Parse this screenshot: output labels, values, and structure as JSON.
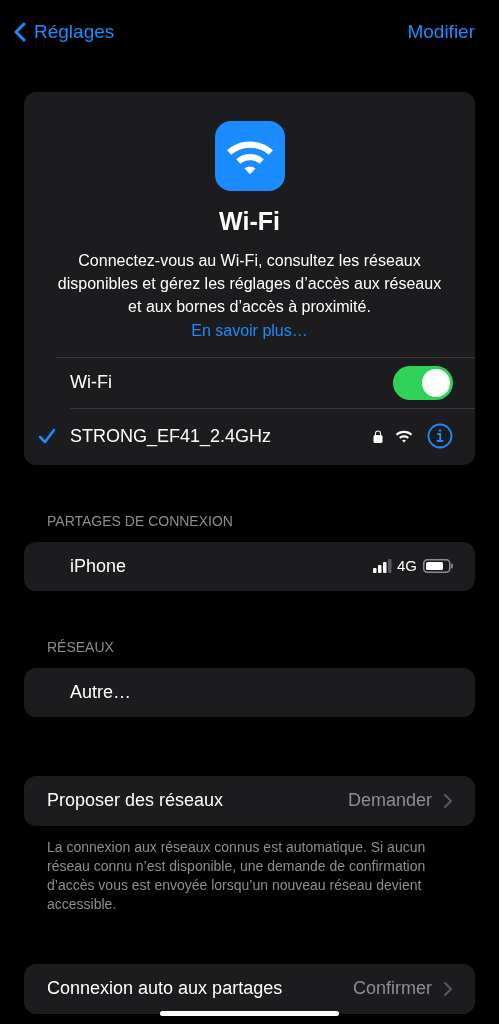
{
  "nav": {
    "back_label": "Réglages",
    "action_label": "Modifier"
  },
  "wifi_card": {
    "title": "Wi-Fi",
    "description": "Connectez-vous au Wi-Fi, consultez les réseaux disponibles et gérez les réglages d’accès aux réseaux et aux bornes d’accès à proximité.",
    "link": "En savoir plus…",
    "toggle": {
      "label": "Wi-Fi",
      "on": true
    },
    "network": {
      "name": "STRONG_EF41_2.4GHz",
      "connected": true,
      "locked": true
    }
  },
  "hotspots": {
    "header": "PARTAGES DE CONNEXION",
    "items": [
      {
        "name": "iPhone",
        "network_type": "4G"
      }
    ]
  },
  "networks": {
    "header": "RÉSEAUX",
    "items": [
      {
        "name": "Autre…"
      }
    ]
  },
  "settings": [
    {
      "label": "Proposer des réseaux",
      "value": "Demander",
      "footer": "La connexion aux réseaux connus est automatique. Si aucun réseau connu n’est disponible, une demande de confirmation d’accès vous est envoyée lorsqu’un nouveau réseau devient accessible."
    },
    {
      "label": "Connexion auto aux partages",
      "value": "Confirmer"
    }
  ]
}
